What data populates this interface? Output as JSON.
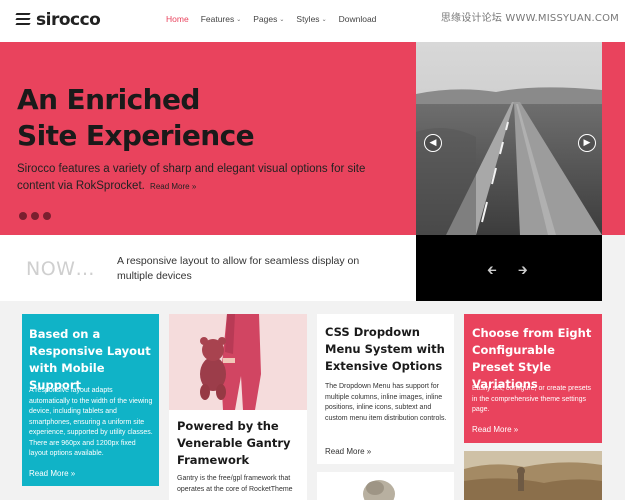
{
  "header": {
    "logo_text": "sirocco",
    "nav": [
      {
        "label": "Home",
        "dropdown": false,
        "active": true
      },
      {
        "label": "Features",
        "dropdown": true,
        "active": false
      },
      {
        "label": "Pages",
        "dropdown": true,
        "active": false
      },
      {
        "label": "Styles",
        "dropdown": true,
        "active": false
      },
      {
        "label": "Download",
        "dropdown": false,
        "active": false
      }
    ],
    "watermark": "思缘设计论坛  WWW.MISSYUAN.COM"
  },
  "hero": {
    "title_line1": "An Enriched",
    "title_line2": "Site Experience",
    "description": "Sirocco features a variety of sharp and elegant visual options for site content via RokSprocket.",
    "read_more": "Read More »",
    "slide_count": 3,
    "active_slide": 1
  },
  "now": {
    "label": "NOW…",
    "text": "A responsive layout to allow for seamless display on multiple devices"
  },
  "cards": {
    "responsive": {
      "title": "Based on a Responsive Layout with Mobile Support",
      "body": "A responsive layout adapts automatically to the width of the viewing device, including tablets and smartphones, ensuring a uniform site experience, supported by utility classes. There are 960px and 1200px fixed layout options available.",
      "read_more": "Read More »"
    },
    "gantry": {
      "title": "Powered by the Venerable Gantry Framework",
      "body": "Gantry is the free/gpl framework that operates at the core of RocketTheme"
    },
    "dropdown": {
      "title": "CSS Dropdown Menu System with Extensive Options",
      "body": "The Dropdown Menu has support for multiple columns, inline images, inline positions, inline icons, subtext and custom menu item distribution controls.",
      "read_more": "Read More »"
    },
    "styles": {
      "title": "Choose from Eight Configurable Preset Style Variations",
      "body": "Easily set, configure, or create presets in the comprehensive theme settings page.",
      "read_more": "Read More »"
    }
  },
  "colors": {
    "accent_pink": "#e9435d",
    "accent_teal": "#10b3c7",
    "dark": "#1a1a1a"
  }
}
